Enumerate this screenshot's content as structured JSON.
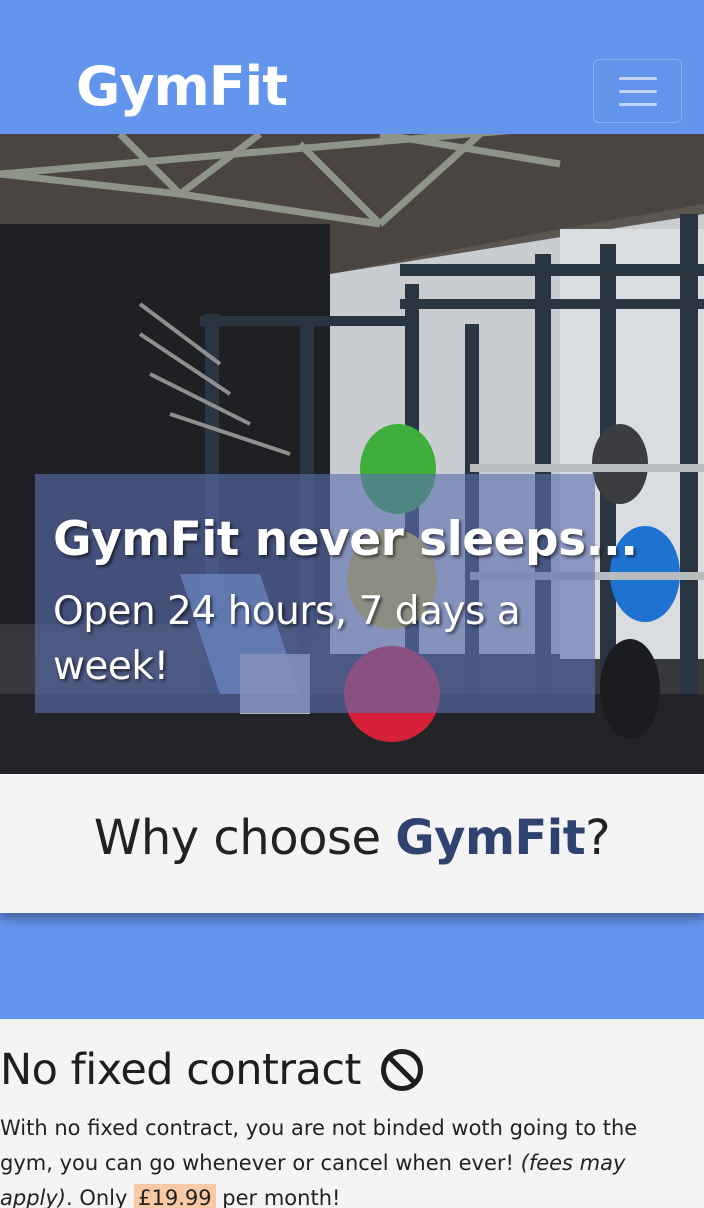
{
  "navbar": {
    "brand": "GymFit",
    "toggle_icon": "hamburger-menu-icon",
    "background": "#6495ed"
  },
  "hero": {
    "title_brand": "GymFit",
    "title_rest": " never sleeps...",
    "subtitle": "Open 24 hours, 7 days a week!",
    "image": "gym-interior-photo"
  },
  "why": {
    "prefix": "Why choose ",
    "brand": "GymFit",
    "suffix": "?"
  },
  "feature": {
    "heading": "No fixed contract",
    "icon": "ban-icon",
    "text_intro": "With no fixed contract, you are not binded woth going to the gym, you can go whenever or cancel when ever! ",
    "text_italic": "(fees may apply)",
    "text_mid": ". Only ",
    "price": "£19.99",
    "text_end": " per month!"
  },
  "colors": {
    "primary": "#6495ed",
    "accent_dark": "#2e4370",
    "price_highlight": "#f7c9a4"
  }
}
